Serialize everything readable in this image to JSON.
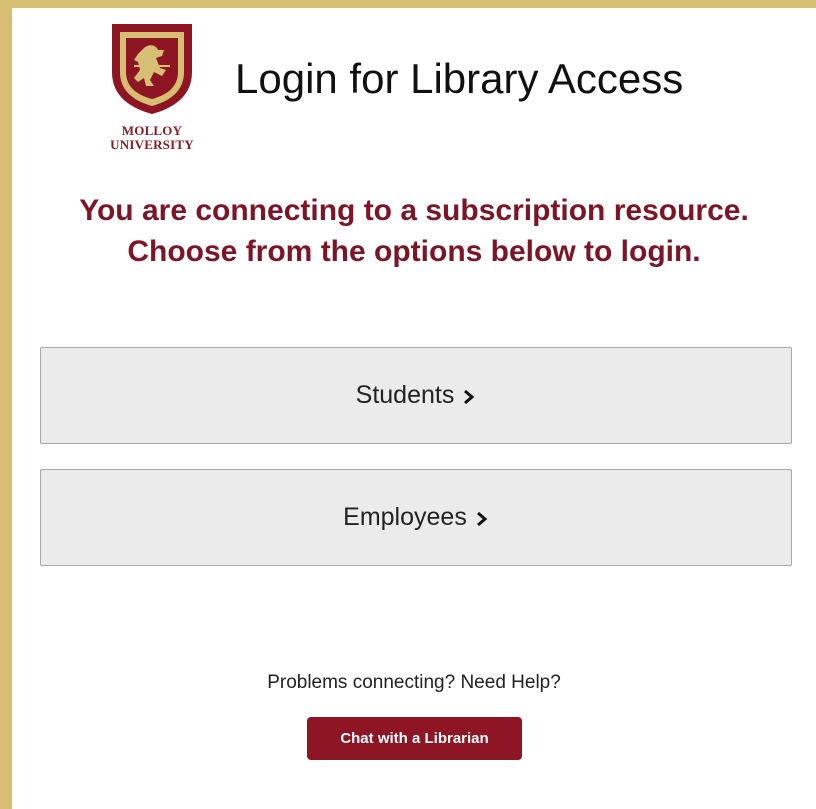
{
  "header": {
    "logo_line1": "MOLLOY",
    "logo_line2": "UNIVERSITY",
    "title": "Login for Library Access"
  },
  "message": {
    "line1": "You are connecting to a subscription resource.",
    "line2": "Choose from the options below to login."
  },
  "options": [
    {
      "label": "Students",
      "icon": "chevron-right-icon"
    },
    {
      "label": "Employees",
      "icon": "chevron-right-icon"
    }
  ],
  "help": {
    "text": "Problems connecting? Need Help?",
    "chat_label": "Chat with a Librarian"
  },
  "colors": {
    "frame": "#d6bf73",
    "brand_maroon": "#7e1526",
    "button_bg": "#ebebeb",
    "chat_button": "#8e1524"
  }
}
